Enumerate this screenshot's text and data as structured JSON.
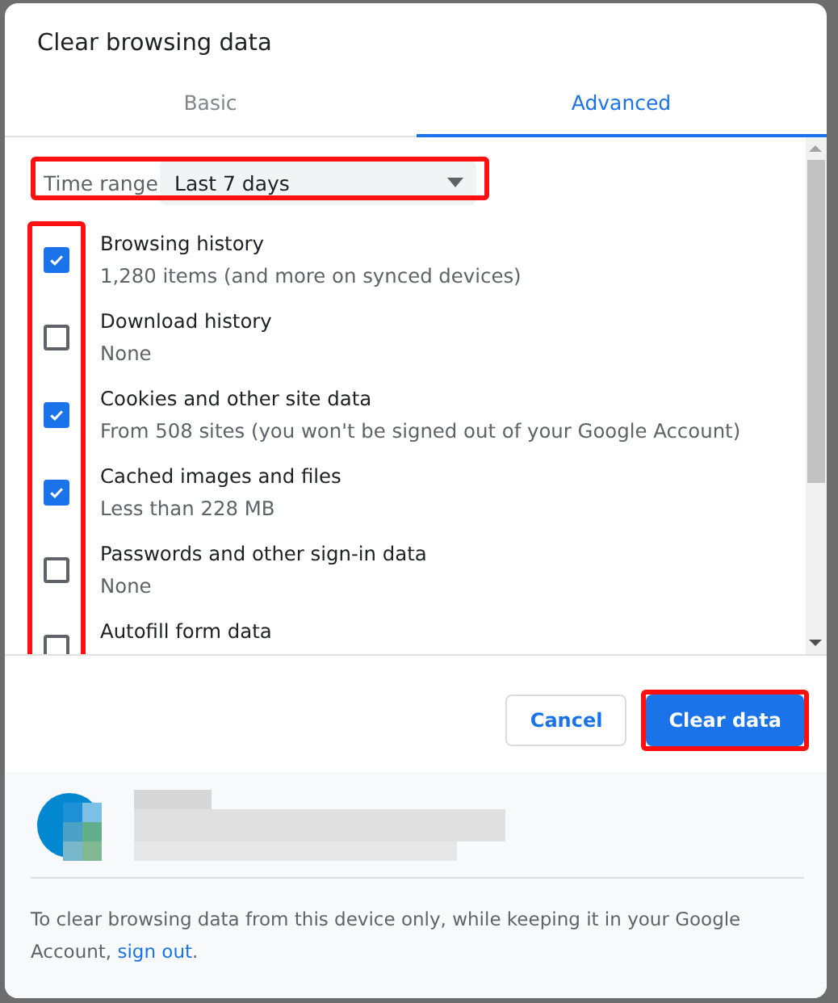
{
  "dialog": {
    "title": "Clear browsing data"
  },
  "tabs": [
    {
      "label": "Basic",
      "selected": false
    },
    {
      "label": "Advanced",
      "selected": true
    }
  ],
  "time_range": {
    "label": "Time range",
    "value": "Last 7 days",
    "highlighted": true
  },
  "checkbox_column_highlighted": true,
  "items": [
    {
      "label": "Browsing history",
      "detail": "1,280 items (and more on synced devices)",
      "checked": true
    },
    {
      "label": "Download history",
      "detail": "None",
      "checked": false
    },
    {
      "label": "Cookies and other site data",
      "detail": "From 508 sites (you won't be signed out of your Google Account)",
      "checked": true
    },
    {
      "label": "Cached images and files",
      "detail": "Less than 228 MB",
      "checked": true
    },
    {
      "label": "Passwords and other sign-in data",
      "detail": "None",
      "checked": false
    },
    {
      "label": "Autofill form data",
      "checked": false
    }
  ],
  "buttons": [
    {
      "label": "Cancel",
      "kind": "secondary",
      "highlighted": false
    },
    {
      "label": "Clear data",
      "kind": "primary",
      "highlighted": true
    }
  ],
  "footer": {
    "text": "To clear browsing data from this device only, while keeping it in your Google Account, ",
    "link": "sign out",
    "end": "."
  }
}
